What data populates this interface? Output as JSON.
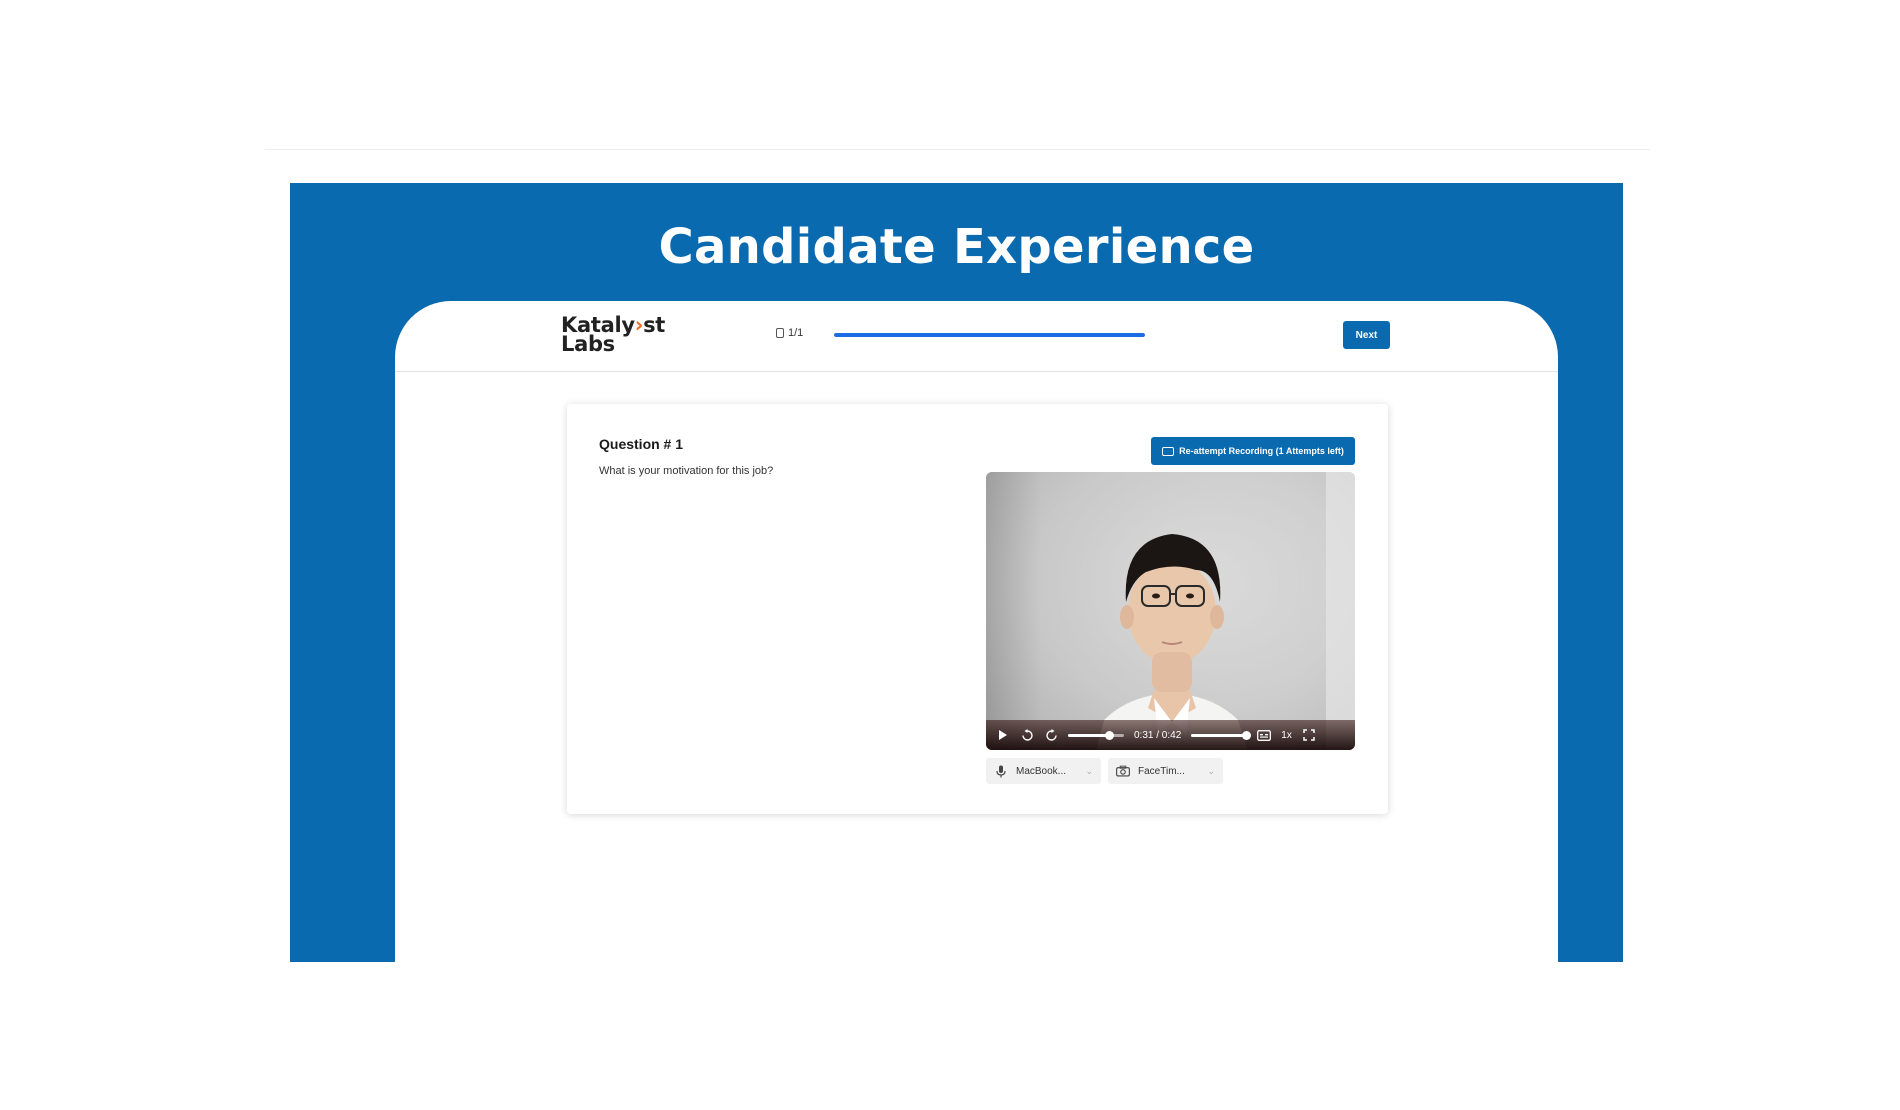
{
  "banner": {
    "title": "Candidate Experience"
  },
  "header": {
    "logo_line1_a": "Kataly",
    "logo_line1_b": "st",
    "logo_line2": "Labs",
    "progress_count": "1/1",
    "progress_fraction": 1.0,
    "next_label": "Next"
  },
  "question": {
    "title": "Question # 1",
    "text": "What is your motivation for this job?",
    "reattempt_label": "Re-attempt Recording (1 Attempts left)"
  },
  "player": {
    "time": "0:31 / 0:42",
    "progress_fraction": 0.738,
    "volume_fraction": 0.98,
    "speed": "1x"
  },
  "devices": {
    "microphone": "MacBook...",
    "camera": "FaceTim..."
  },
  "colors": {
    "brand_blue": "#0a6ab0",
    "progress_blue": "#1b6de3",
    "logo_accent": "#ef6b1f"
  }
}
